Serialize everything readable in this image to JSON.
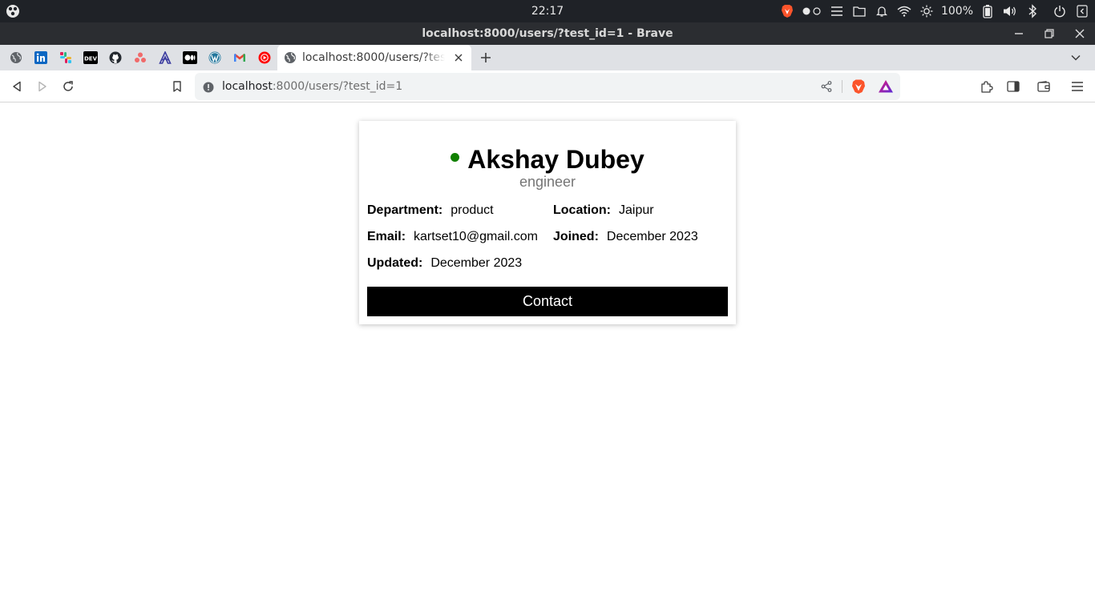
{
  "system_bar": {
    "clock": "22:17",
    "battery_percent": "100%",
    "icons": [
      "launcher-icon",
      "brave-tray-icon",
      "workspace-dots-icon",
      "menu-icon",
      "files-icon",
      "notifications-icon",
      "wifi-icon",
      "brightness-icon",
      "battery-icon",
      "volume-icon",
      "bluetooth-icon",
      "power-icon",
      "panel-collapse-icon"
    ]
  },
  "window": {
    "title": "localhost:8000/users/?test_id=1 - Brave"
  },
  "tabs": {
    "pinned": [
      "globe-icon",
      "linkedin-icon",
      "slack-icon",
      "dev-icon",
      "github-icon",
      "asana-icon",
      "arc-icon",
      "medium-icon",
      "wordpress-icon",
      "gmail-icon",
      "youtube-music-icon"
    ],
    "active": {
      "title": "localhost:8000/users/?test_id=1"
    }
  },
  "address_bar": {
    "host": "localhost",
    "rest": ":8000/users/?test_id=1"
  },
  "profile": {
    "name": "Akshay Dubey",
    "status_color": "#118000",
    "role": "engineer",
    "department_label": "Department:",
    "department": "product",
    "location_label": "Location:",
    "location": "Jaipur",
    "email_label": "Email:",
    "email": "kartset10@gmail.com",
    "joined_label": "Joined:",
    "joined": "December 2023",
    "updated_label": "Updated:",
    "updated": "December 2023",
    "contact_label": "Contact"
  }
}
